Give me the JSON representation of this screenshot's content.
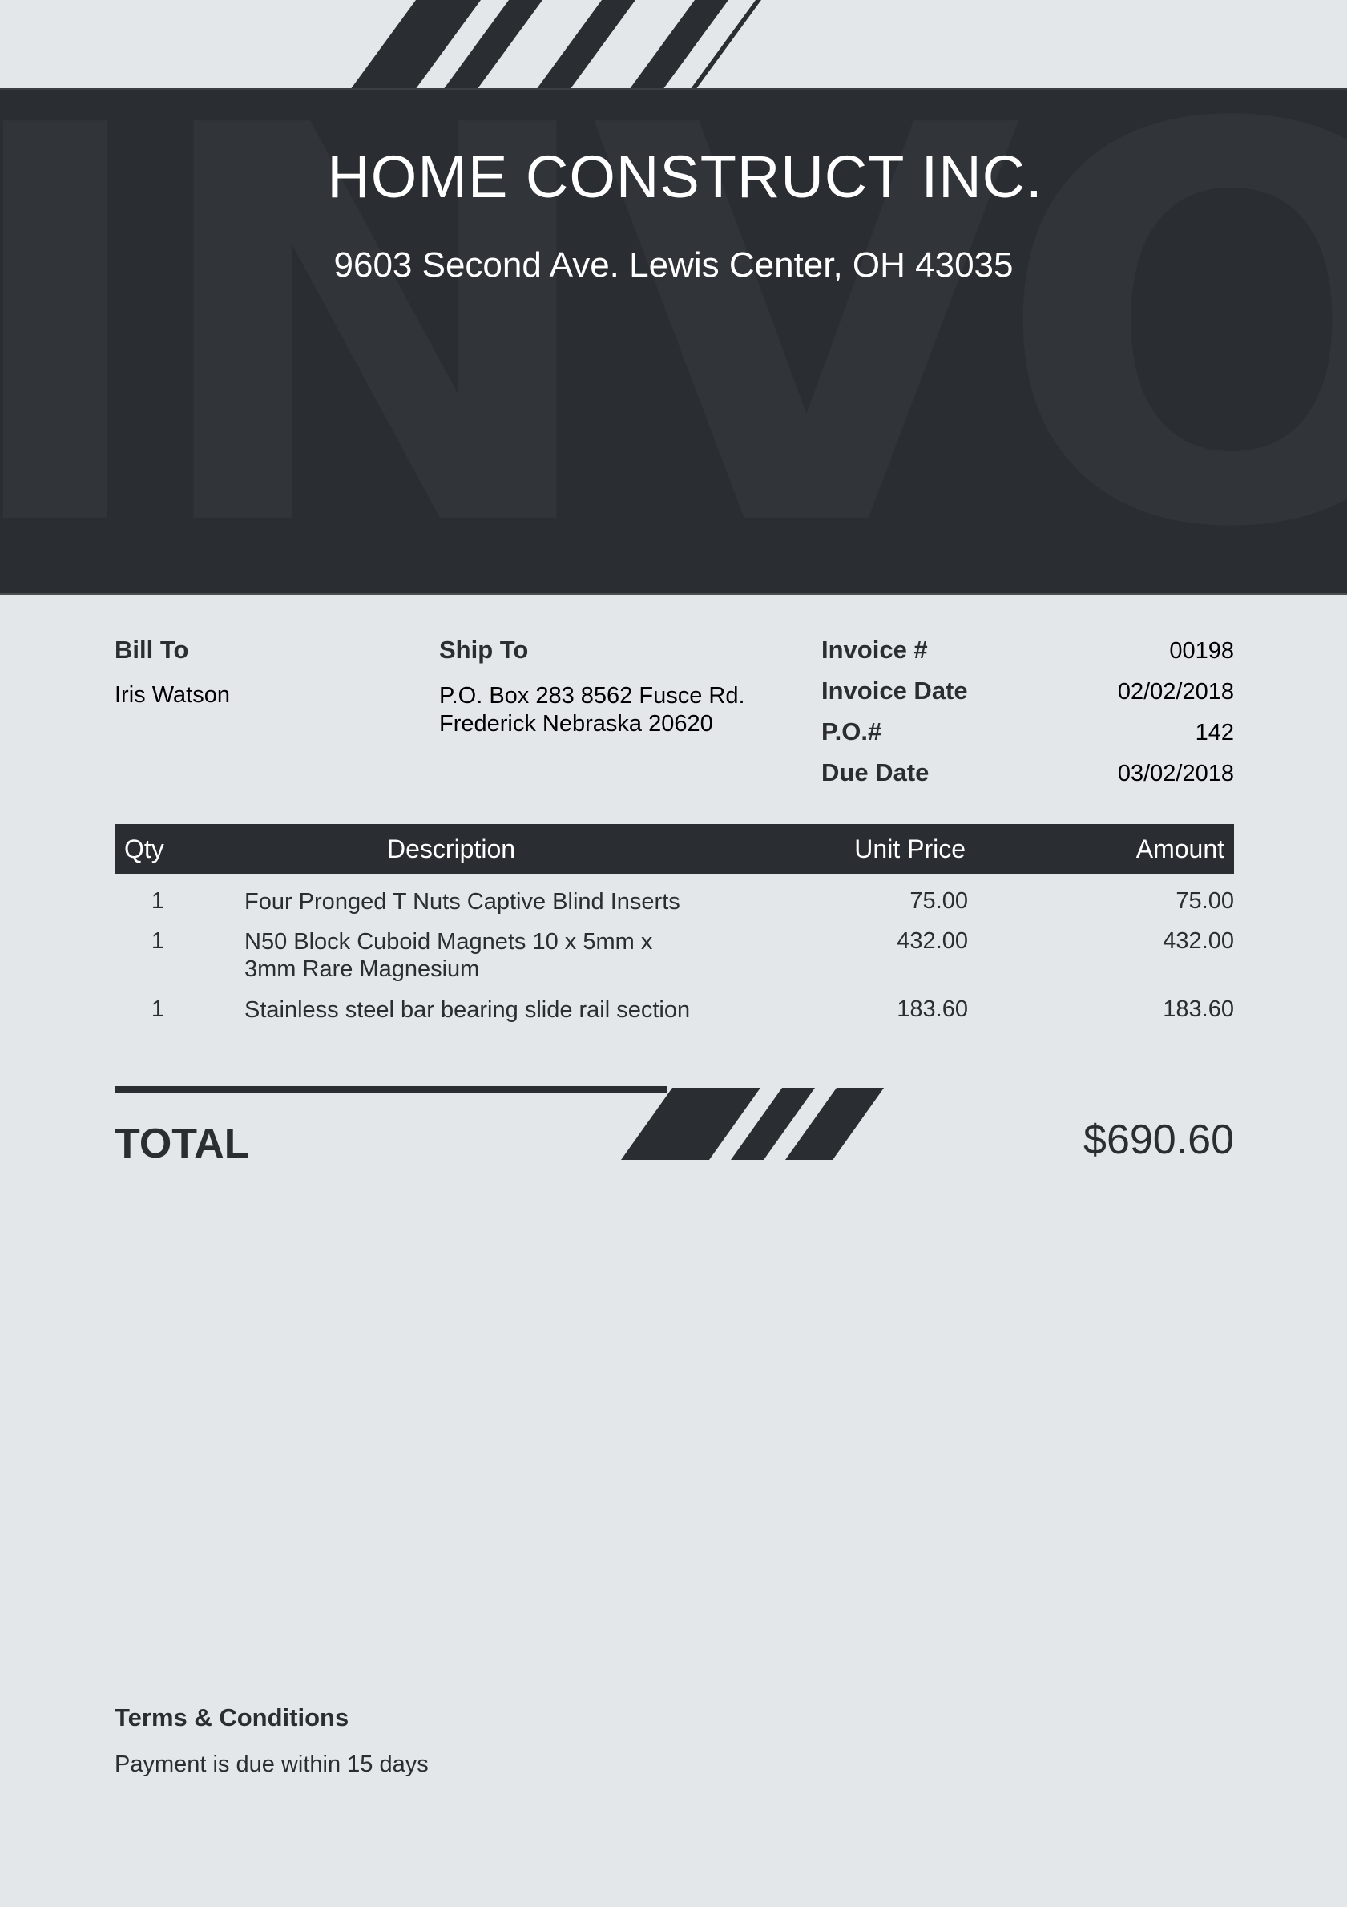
{
  "header": {
    "watermark": "INVOICE",
    "company_name": "HOME CONSTRUCT INC.",
    "company_address": "9603 Second Ave. Lewis Center, OH 43035"
  },
  "bill_to": {
    "label": "Bill To",
    "name": "Iris Watson"
  },
  "ship_to": {
    "label": "Ship To",
    "address": "P.O. Box 283 8562 Fusce Rd. Frederick Nebraska 20620"
  },
  "meta": [
    {
      "label": "Invoice #",
      "value": "00198"
    },
    {
      "label": "Invoice Date",
      "value": "02/02/2018"
    },
    {
      "label": "P.O.#",
      "value": "142"
    },
    {
      "label": "Due Date",
      "value": "03/02/2018"
    }
  ],
  "table": {
    "headers": {
      "qty": "Qty",
      "description": "Description",
      "unit_price": "Unit Price",
      "amount": "Amount"
    },
    "rows": [
      {
        "qty": "1",
        "description": "Four Pronged T Nuts Captive Blind Inserts",
        "unit_price": "75.00",
        "amount": "75.00"
      },
      {
        "qty": "1",
        "description": "N50 Block Cuboid Magnets 10 x 5mm x 3mm Rare Magnesium",
        "unit_price": "432.00",
        "amount": "432.00"
      },
      {
        "qty": "1",
        "description": "Stainless steel bar bearing slide rail section",
        "unit_price": "183.60",
        "amount": "183.60"
      }
    ]
  },
  "total": {
    "label": "TOTAL",
    "value": "$690.60"
  },
  "terms": {
    "title": "Terms & Conditions",
    "text": "Payment is due within 15 days"
  },
  "colors": {
    "background": "#e3e7ea",
    "dark": "#2a2d31",
    "text": "#2b2e31"
  }
}
